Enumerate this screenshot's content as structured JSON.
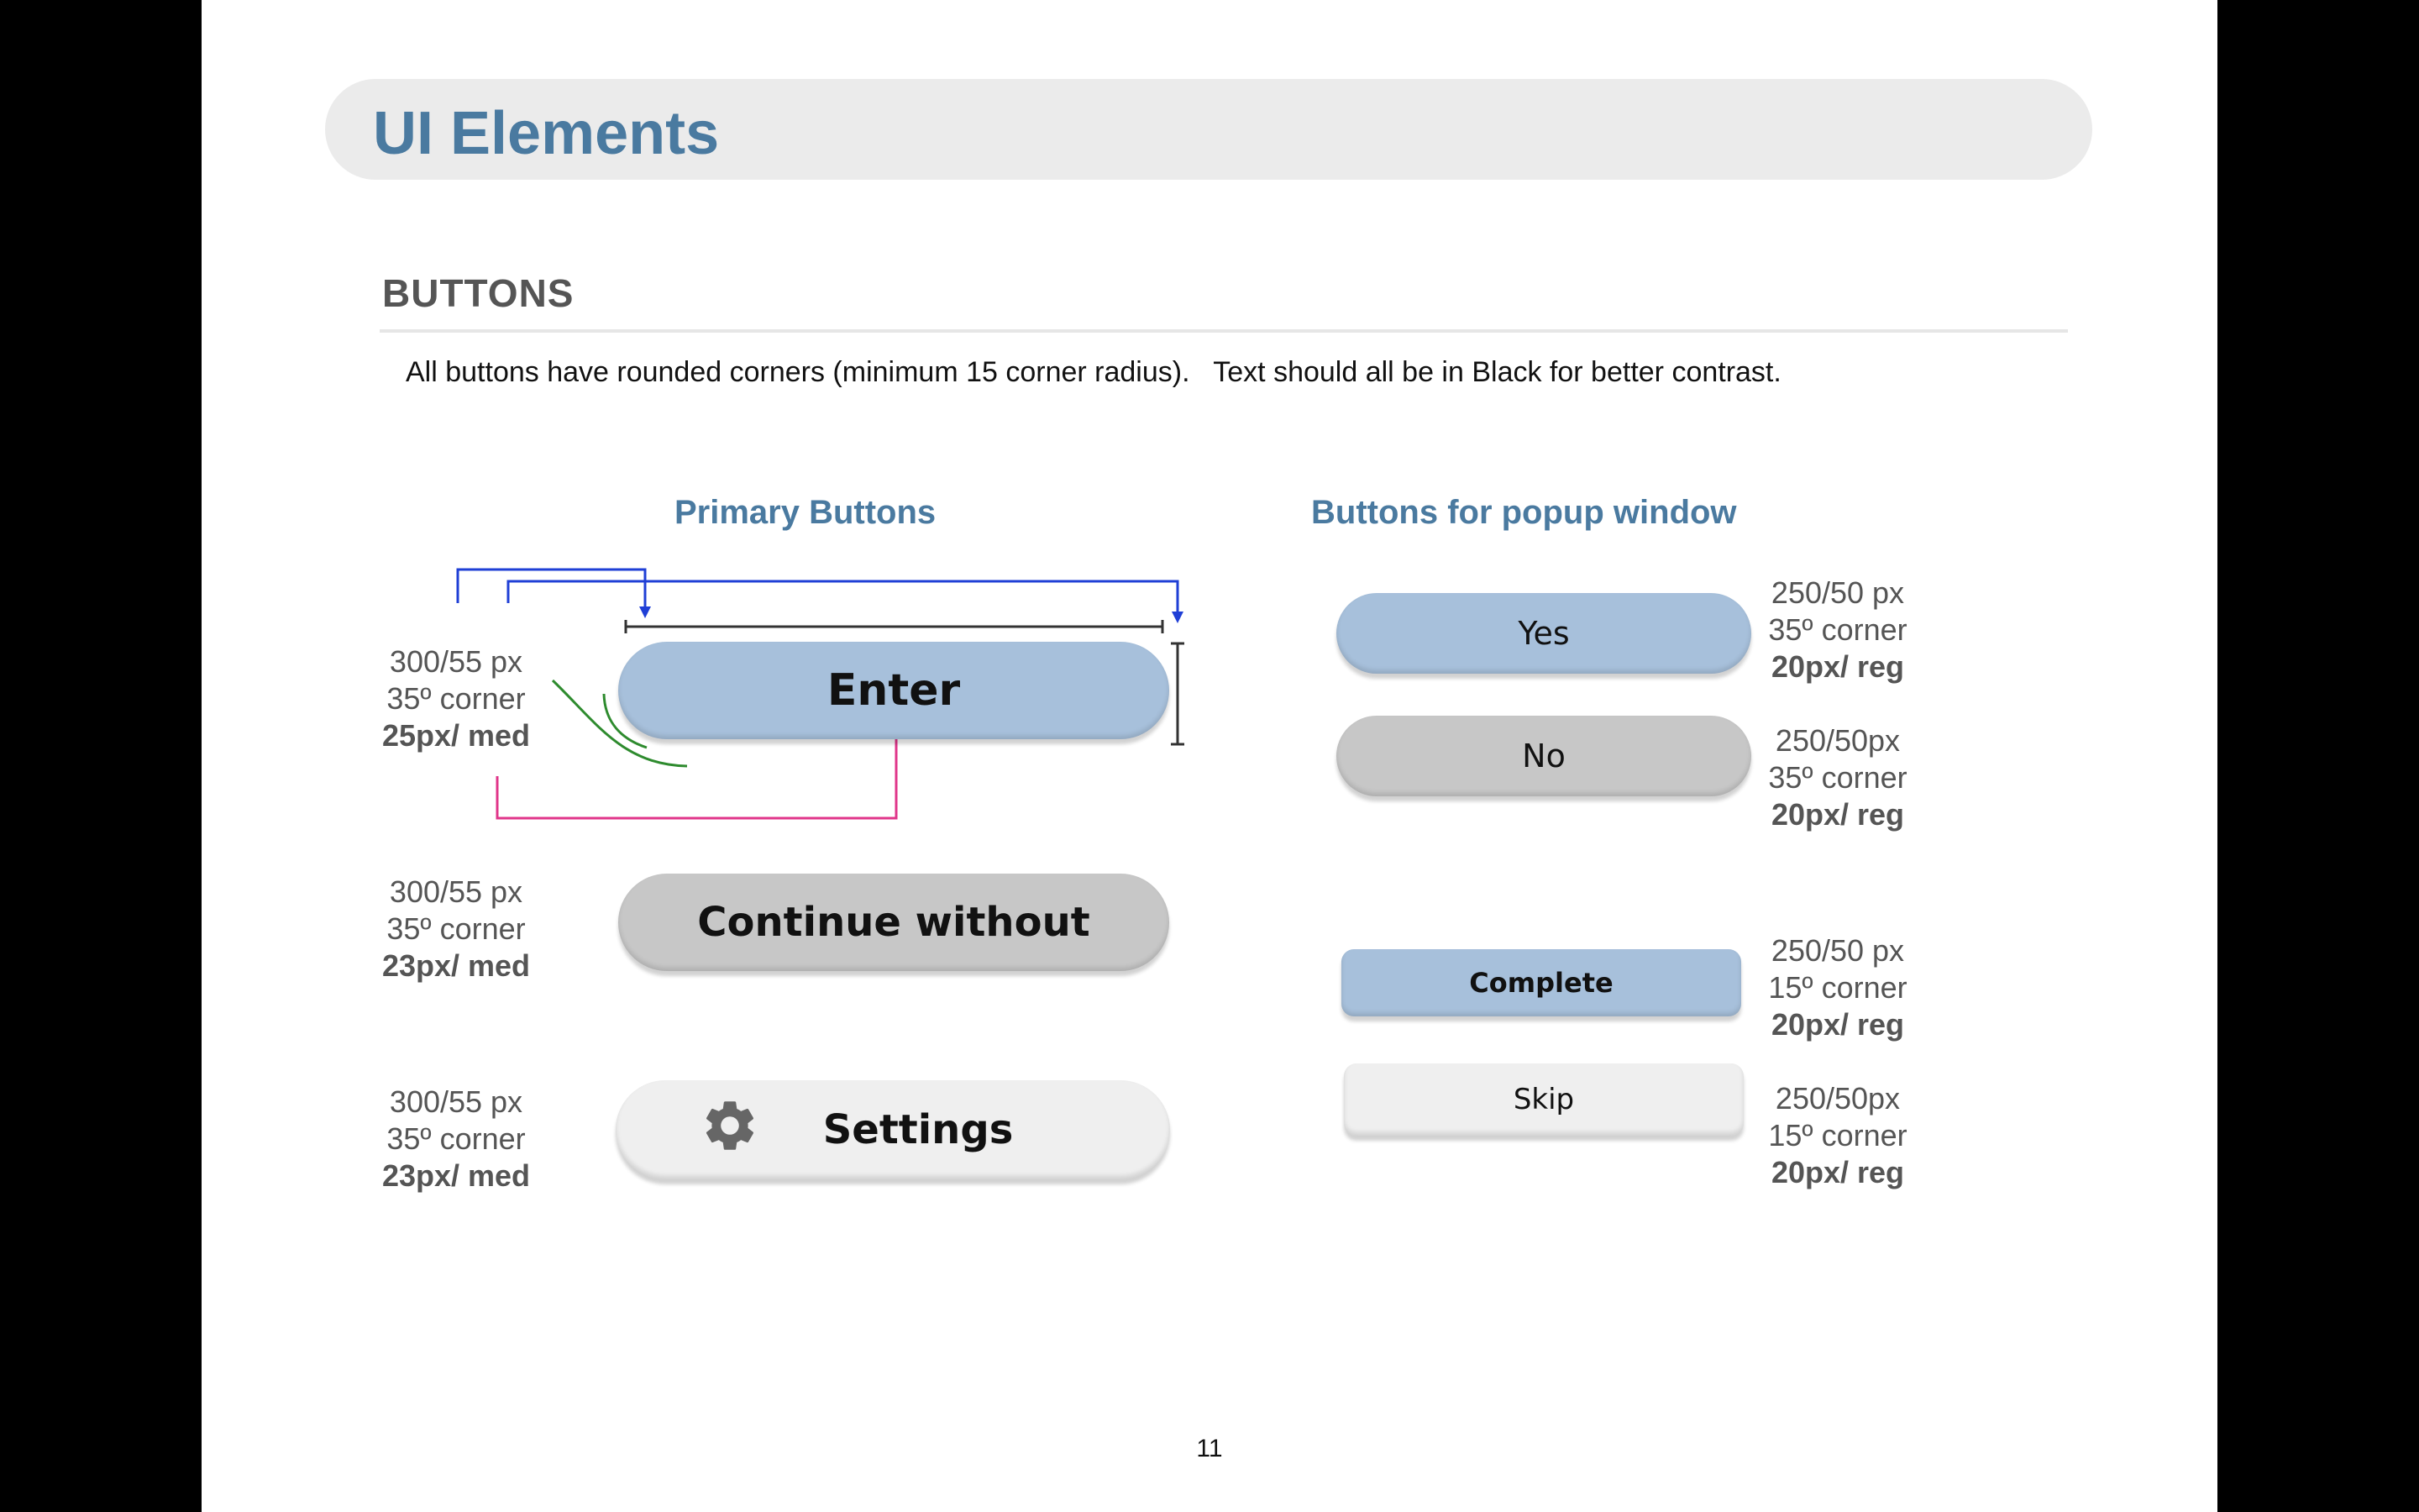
{
  "page": {
    "title": "UI Elements",
    "section_title": "BUTTONS",
    "intro": "All buttons have rounded corners (minimum 15 corner radius).   Text should all be in Black for better contrast.",
    "page_number": "11"
  },
  "primary": {
    "heading": "Primary Buttons",
    "buttons": [
      {
        "label": "Enter",
        "spec": [
          "300/55 px",
          "35º corner",
          "25px/ med"
        ]
      },
      {
        "label": "Continue without",
        "spec": [
          "300/55 px",
          "35º corner",
          "23px/ med"
        ]
      },
      {
        "label": "Settings",
        "icon": "gear-icon",
        "spec": [
          "300/55 px",
          "35º corner",
          "23px/ med"
        ]
      }
    ]
  },
  "popup": {
    "heading": "Buttons for popup window",
    "buttons": [
      {
        "label": "Yes",
        "spec": [
          "250/50 px",
          "35º corner",
          "20px/ reg"
        ]
      },
      {
        "label": "No",
        "spec": [
          "250/50px",
          "35º corner",
          "20px/ reg"
        ]
      },
      {
        "label": "Complete",
        "spec": [
          "250/50 px",
          "15º corner",
          "20px/ reg"
        ]
      },
      {
        "label": "Skip",
        "spec": [
          "250/50px",
          "15º corner",
          "20px/ reg"
        ]
      }
    ]
  },
  "colors": {
    "accent": "#4a7aa0",
    "button_blue": "#a7c0db",
    "button_grey": "#c7c7c7",
    "button_light": "#efefef",
    "annotation_blue": "#1f3fd6",
    "annotation_pink": "#e0358a",
    "annotation_green": "#2e8b2e"
  }
}
